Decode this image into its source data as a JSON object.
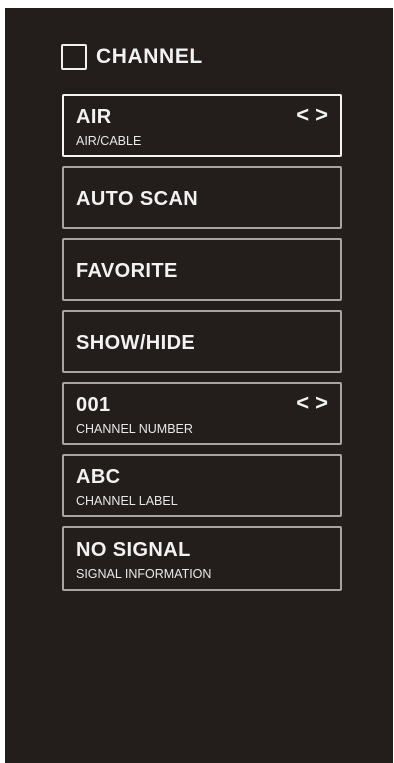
{
  "menu": {
    "title": "CHANNEL",
    "items": [
      {
        "label": "AIR",
        "sub": "AIR/CABLE",
        "arrows": [
          "<",
          ">"
        ],
        "selected": true
      },
      {
        "label": "AUTO SCAN"
      },
      {
        "label": "FAVORITE"
      },
      {
        "label": "SHOW/HIDE"
      },
      {
        "label": "001",
        "sub": "CHANNEL NUMBER",
        "arrows": [
          "<",
          ">"
        ]
      },
      {
        "label": "ABC",
        "sub": "CHANNEL LABEL"
      },
      {
        "label": "NO SIGNAL",
        "sub": "SIGNAL INFORMATION"
      }
    ]
  },
  "colors": {
    "background": "#231d1b",
    "text": "#f2f2f2",
    "border": "#a8a4a2",
    "selected_border": "#f5f5f5"
  }
}
